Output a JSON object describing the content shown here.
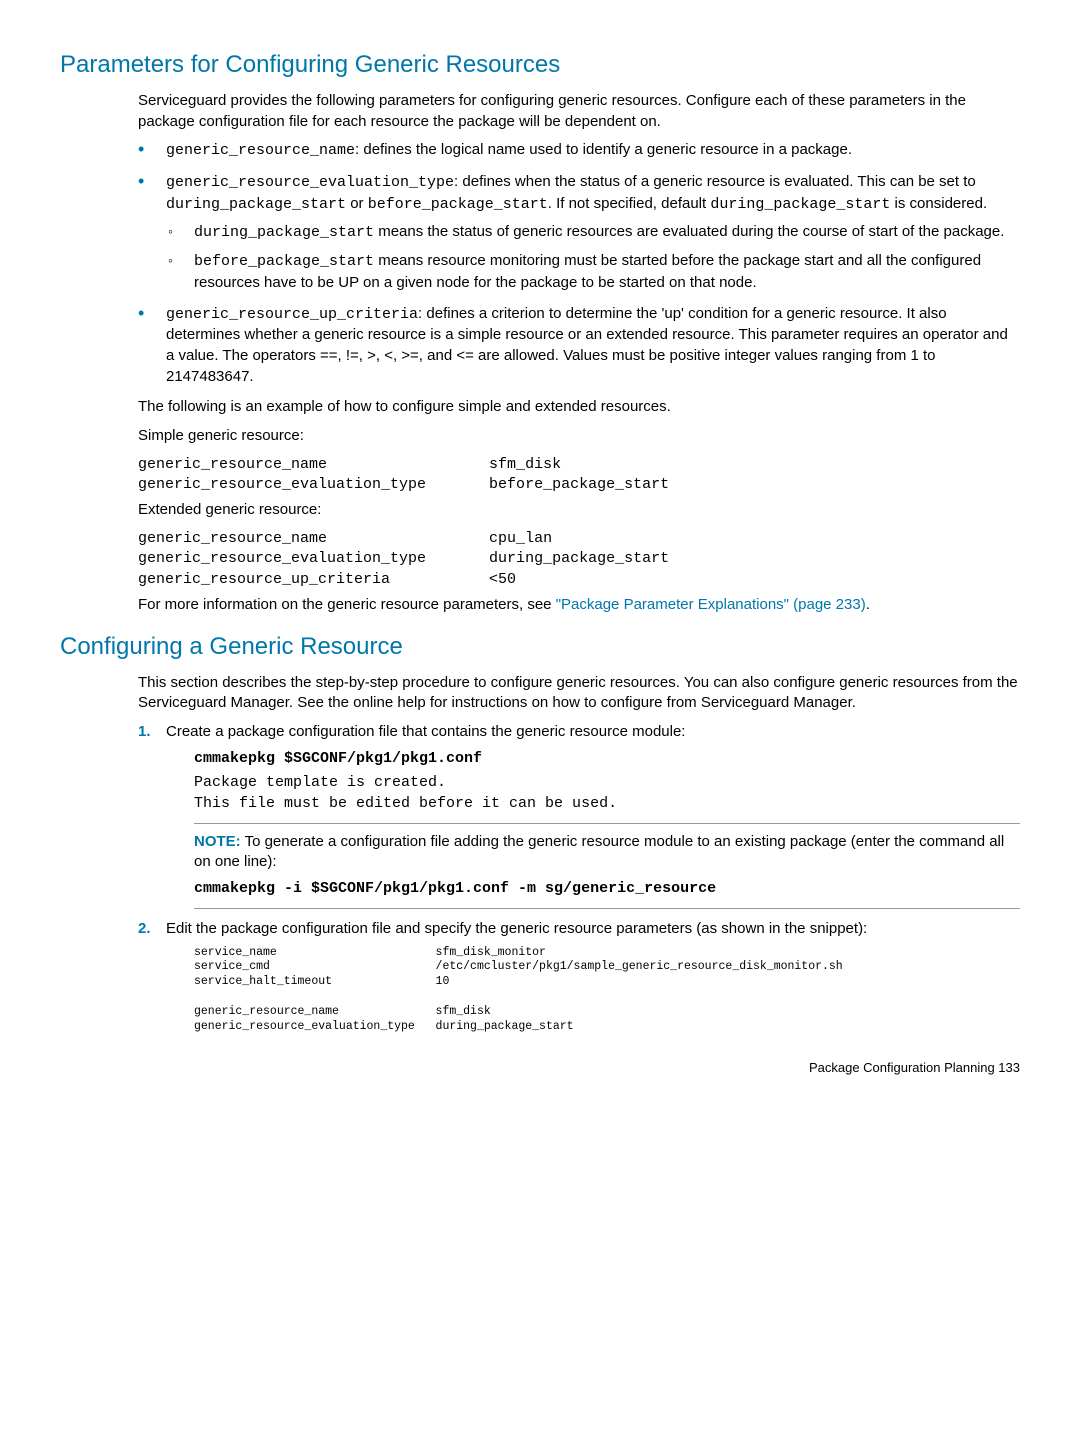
{
  "section1": {
    "heading": "Parameters for Configuring Generic Resources",
    "intro": "Serviceguard provides the following parameters for configuring generic resources. Configure each of these parameters in the package configuration file for each resource the package will be dependent on.",
    "item1_code": "generic_resource_name",
    "item1_text": ": defines the logical name used to identify a generic resource in a package.",
    "item2_code": "generic_resource_evaluation_type",
    "item2_a": ": defines when the status of a generic resource is evaluated. This can be set to ",
    "item2_code_b": "during_package_start",
    "item2_b": " or ",
    "item2_code_c": "before_package_start",
    "item2_c": ". If not specified, default ",
    "item2_code_d": "during_package_start",
    "item2_d": " is considered.",
    "sub1_code": "during_package_start",
    "sub1_text": " means the status of generic resources are evaluated during the course of start of the package.",
    "sub2_code": "before_package_start",
    "sub2_text": " means resource monitoring must be started before the package start and all the configured resources have to be UP on a given node for the package to be started on that node.",
    "item3_code": "generic_resource_up_criteria",
    "item3_text": ": defines a criterion to determine the 'up' condition for a generic resource. It also determines whether a generic resource is a simple resource or an extended resource. This parameter requires an operator and a value. The operators ==, !=, >, <, >=, and <= are allowed. Values must be positive integer values ranging from 1 to 2147483647.",
    "example_intro": "The following is an example of how to configure simple and extended resources.",
    "simple_label": "Simple generic resource:",
    "simple_block": "generic_resource_name                  sfm_disk\ngeneric_resource_evaluation_type       before_package_start",
    "extended_label": "Extended generic resource:",
    "extended_block": "generic_resource_name                  cpu_lan\ngeneric_resource_evaluation_type       during_package_start\ngeneric_resource_up_criteria           <50",
    "more_a": "For more information on the generic resource parameters, see ",
    "more_link": "\"Package Parameter Explanations\" (page 233)",
    "more_b": "."
  },
  "section2": {
    "heading": "Configuring a Generic Resource",
    "intro": "This section describes the step-by-step procedure to configure generic resources. You can also configure generic resources from the Serviceguard Manager. See the online help for instructions on how to configure from Serviceguard Manager.",
    "step1_num": "1.",
    "step1_text": "Create a package configuration file that contains the generic resource module:",
    "step1_cmd": "cmmakepkg $SGCONF/pkg1/pkg1.conf",
    "step1_out": "Package template is created.\nThis file must be edited before it can be used.",
    "note_label": "NOTE:",
    "note_text": "To generate a configuration file adding the generic resource module to an existing package (enter the command all on one line):",
    "note_cmd": "cmmakepkg -i $SGCONF/pkg1/pkg1.conf -m sg/generic_resource",
    "step2_num": "2.",
    "step2_text": "Edit the package configuration file and specify the generic resource parameters (as shown in the snippet):",
    "step2_block": "service_name                       sfm_disk_monitor\nservice_cmd                        /etc/cmcluster/pkg1/sample_generic_resource_disk_monitor.sh\nservice_halt_timeout               10\n\ngeneric_resource_name              sfm_disk\ngeneric_resource_evaluation_type   during_package_start"
  },
  "footer": "Package Configuration Planning    133"
}
